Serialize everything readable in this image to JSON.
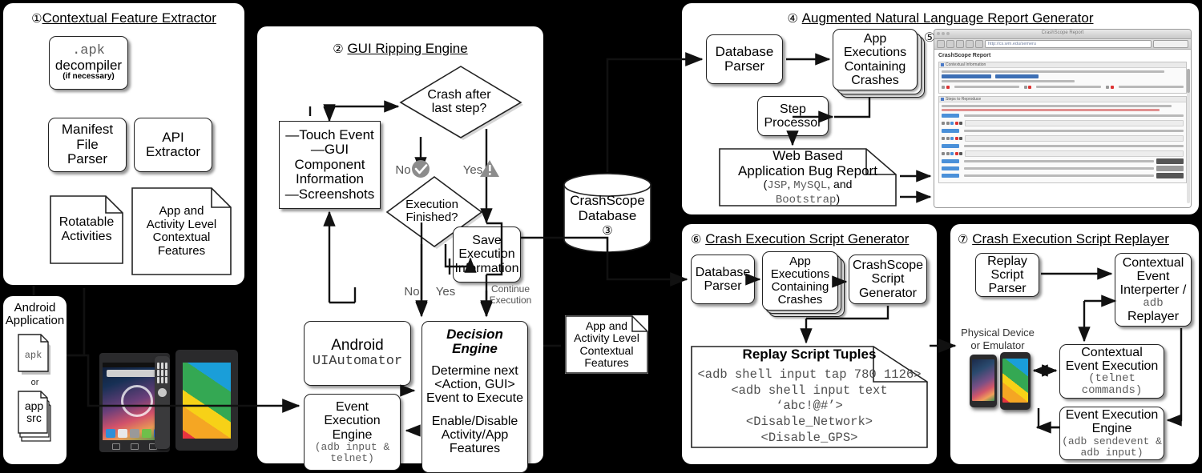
{
  "panels": {
    "p1": {
      "num": "①",
      "title": "Contextual Feature Extractor"
    },
    "p2": {
      "num": "②",
      "title": "GUI Ripping Engine"
    },
    "p4": {
      "num": "④",
      "title": "Augmented Natural Language Report Generator"
    },
    "p5": {
      "num": "⑤"
    },
    "p6": {
      "num": "⑥",
      "title": "Crash Execution Script Generator"
    },
    "p7": {
      "num": "⑦",
      "title": "Crash Execution Script Replayer"
    }
  },
  "p1": {
    "decompiler": {
      "l1": ".apk",
      "l2": "decompiler",
      "l3": "(if necessary)"
    },
    "manifest": {
      "l1": "Manifest",
      "l2": "File",
      "l3": "Parser"
    },
    "api": {
      "l1": "API",
      "l2": "Extractor"
    },
    "rotatable": {
      "l1": "Rotatable",
      "l2": "Activities"
    },
    "features": {
      "l1": "App and",
      "l2": "Activity Level",
      "l3": "Contextual",
      "l4": "Features"
    }
  },
  "p2": {
    "crash_diamond": {
      "l1": "Crash after",
      "l2": "last step?"
    },
    "exec_diamond": {
      "l1": "Execution",
      "l2": "Finished?"
    },
    "capture": {
      "l1": "—Touch Event",
      "l2": "—GUI",
      "l3": "Component",
      "l4": "Information",
      "l5": "—Screenshots"
    },
    "save": {
      "l1": "Save",
      "l2": "Execution",
      "l3": "Information"
    },
    "uiautomator": {
      "l1": "Android",
      "l2": "UIAutomator"
    },
    "event_engine": {
      "l1": "Event",
      "l2": "Execution",
      "l3": "Engine",
      "l4": "(adb input &",
      "l5": "telnet)"
    },
    "decision": {
      "title": "Decision Engine",
      "l1": "Determine next",
      "l2": "<Action, GUI>",
      "l3": "Event to Execute",
      "l4": "Enable/Disable",
      "l5": "Activity/App",
      "l6": "Features"
    },
    "labels": {
      "no1": "No",
      "yes1": "Yes",
      "no2": "No",
      "yes2": "Yes",
      "continue1": "Continue",
      "continue2": "Execution"
    },
    "icons": {
      "ok": "check-circle-icon",
      "warn": "warning-triangle-icon"
    }
  },
  "p3": {
    "l1": "CrashScope",
    "l2": "Database",
    "num": "③"
  },
  "mid_doc": {
    "l1": "App and",
    "l2": "Activity Level",
    "l3": "Contextual",
    "l4": "Features"
  },
  "p4": {
    "db_parser": {
      "l1": "Database",
      "l2": "Parser"
    },
    "executions": {
      "l1": "App",
      "l2": "Executions",
      "l3": "Containing",
      "l4": "Crashes"
    },
    "step": {
      "l1": "Step",
      "l2": "Processor"
    },
    "report": {
      "l1": "Web Based",
      "l2": "Application Bug Report",
      "l3a": "(",
      "l3b": "JSP",
      "l3c": ", ",
      "l3d": "MySQL",
      "l3e": ", and",
      "l4a": "Bootstrap",
      "l4b": ")"
    }
  },
  "p5": {
    "window_title": "CrashScope Report",
    "url": "http://cs.wm.edu/semeru",
    "page_heading": "CrashScope Report",
    "sections": [
      "Contextual Information",
      "Steps to Reproduce"
    ]
  },
  "p6": {
    "db_parser": {
      "l1": "Database",
      "l2": "Parser"
    },
    "executions": {
      "l1": "App",
      "l2": "Executions",
      "l3": "Containing",
      "l4": "Crashes"
    },
    "script_gen": {
      "l1": "CrashScope",
      "l2": "Script",
      "l3": "Generator"
    },
    "tuples": {
      "title": "Replay Script Tuples",
      "lines": [
        "<adb shell input tap 780 1126>",
        "<adb shell input text ‘abc!@#’>",
        "<Disable_Network>",
        "<Disable_GPS>"
      ]
    }
  },
  "p7": {
    "replay_parser": {
      "l1": "Replay",
      "l2": "Script",
      "l3": "Parser"
    },
    "interpreter": {
      "l1": "Contextual",
      "l2": "Event",
      "l3": "Interperter /",
      "l4": "adb",
      "l5": "Replayer"
    },
    "device_label": {
      "l1": "Physical Device",
      "l2": "or Emulator"
    },
    "ctx_exec": {
      "l1": "Contextual",
      "l2": "Event Execution",
      "l3": "(telnet",
      "l4": "commands)"
    },
    "event_engine": {
      "l1": "Event Execution",
      "l2": "Engine",
      "l3": "(adb sendevent &",
      "l4": "adb input)"
    }
  },
  "app": {
    "title1": "Android",
    "title2": "Application",
    "apk": "apk",
    "or": "or",
    "src1": "app",
    "src2": "src"
  },
  "colors": {
    "panel_bg": "#ffffff",
    "page_bg": "#000000",
    "stroke": "#222222",
    "icon_gray": "#8c8c8c",
    "mono_gray": "#5c5c5c",
    "accent_blue": "#4a90d9"
  }
}
